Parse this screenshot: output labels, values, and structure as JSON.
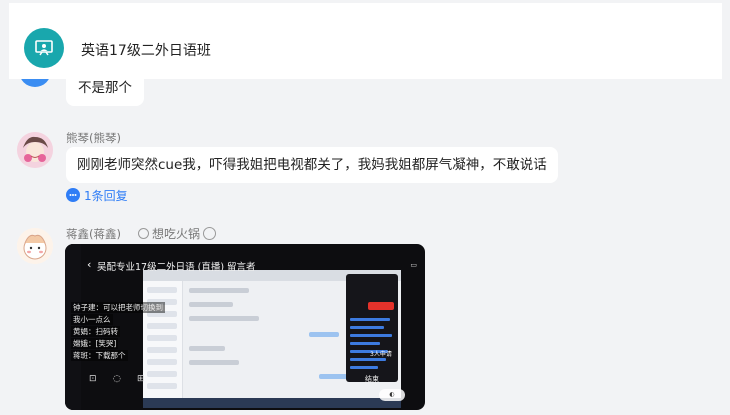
{
  "header": {
    "group_name": "英语17级二外日语班",
    "icon": "chalkboard-teacher-icon"
  },
  "messages": [
    {
      "text": "不是那个",
      "avatar": "blue-avatar"
    },
    {
      "sender": "熊琴(熊琴)",
      "text": "刚刚老师突然cue我，吓得我姐把电视都关了，我妈我姐都屏气凝神，不敢说话",
      "reply_label": "1条回复",
      "avatar": "pink-photo-avatar"
    },
    {
      "sender": "蒋鑫(蒋鑫)",
      "status": "想吃火锅",
      "avatar": "cartoon-avatar",
      "image": {
        "title": "吴配专业17级二外日语 (直播) 留言者",
        "overlay_lines": [
          "钟子建：可以把老师切换到",
          "我小一点么",
          "黄娟：扫码转",
          "嫦娥：[笑哭]",
          "蒋斑：下载那个"
        ],
        "end_label": "结束",
        "join_label": "3人申请"
      }
    }
  ]
}
